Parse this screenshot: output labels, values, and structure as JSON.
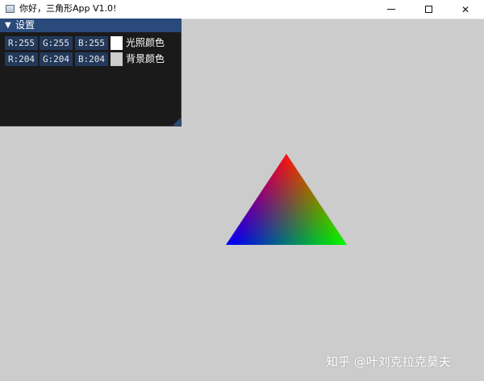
{
  "window": {
    "title": "你好，三角形App V1.0!",
    "icon": "app-window-icon",
    "controls": {
      "minimize": "minimize-icon",
      "maximize": "maximize-icon",
      "close": "close-icon"
    }
  },
  "panel": {
    "title": "设置",
    "collapse_glyph": "▼",
    "rows": [
      {
        "r": "R:255",
        "g": "G:255",
        "b": "B:255",
        "label": "光照颜色",
        "swatch_color": "#ffffff"
      },
      {
        "r": "R:204",
        "g": "G:204",
        "b": "B:204",
        "label": "背景颜色",
        "swatch_color": "#cccccc"
      }
    ]
  },
  "colors": {
    "background": "#cccccc",
    "panel_bg": "#1a1a1a",
    "panel_header": "#294a7a",
    "chip_bg": "#23395b",
    "vertex_top": "#ff0000",
    "vertex_left": "#0000ff",
    "vertex_right": "#00ff00"
  },
  "watermark": "知乎 @叶刘克拉克莫夫"
}
